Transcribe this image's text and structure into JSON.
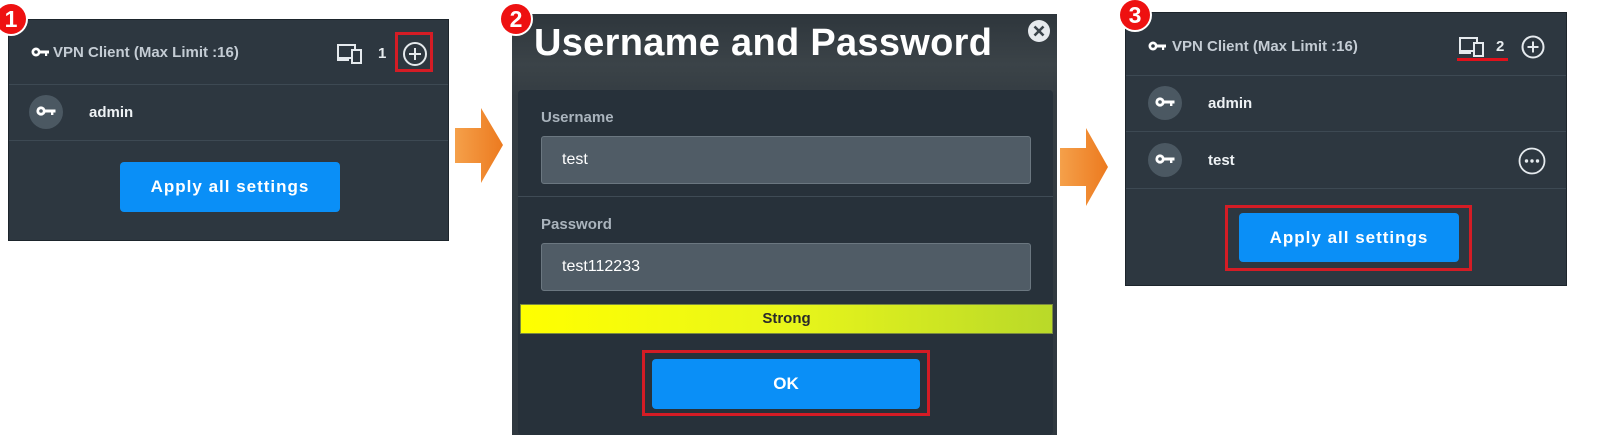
{
  "steps": [
    {
      "number": "1"
    },
    {
      "number": "2"
    },
    {
      "number": "3"
    }
  ],
  "panel1": {
    "title": "VPN Client (Max Limit :16)",
    "count": "1",
    "users": [
      {
        "name": "admin"
      }
    ],
    "apply_label": "Apply all settings"
  },
  "dialog": {
    "title": "Username and Password",
    "username_label": "Username",
    "username_value": "test",
    "password_label": "Password",
    "password_value": "test112233",
    "strength_label": "Strong",
    "ok_label": "OK"
  },
  "panel3": {
    "title": "VPN Client (Max Limit :16)",
    "count": "2",
    "users": [
      {
        "name": "admin"
      },
      {
        "name": "test"
      }
    ],
    "apply_label": "Apply all settings"
  },
  "colors": {
    "panel_bg": "#2d3740",
    "accent_button": "#0a8ff7",
    "highlight_red": "#d41c25",
    "arrow_orange": "#f08a2a"
  }
}
